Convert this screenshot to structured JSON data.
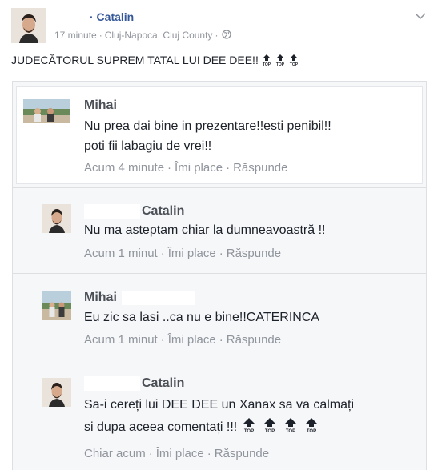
{
  "post": {
    "author": "· Catalin",
    "time": "17 minute",
    "location": "Cluj-Napoca, Cluj County",
    "separator": "·",
    "text": "JUDECĂTORUL SUPREM TATAL LUI DEE DEE!!",
    "top_icon_label": "TOP"
  },
  "comments": [
    {
      "name": "Mihai",
      "lines": [
        "Nu prea dai bine in prezentare!!esti penibil!!",
        "poti fii labagiu de vrei!!"
      ],
      "time": "Acum 4 minute",
      "like": "Îmi place",
      "reply": "Răspunde"
    },
    {
      "name": "Catalin",
      "lines": [
        "Nu ma asteptam chiar la dumneavoastră !!"
      ],
      "time": "Acum 1 minut",
      "like": "Îmi place",
      "reply": "Răspunde"
    },
    {
      "name": "Mihai",
      "lines": [
        "Eu zic sa lasi ..ca nu e bine!!CATERINCA"
      ],
      "time": "Acum 1 minut",
      "like": "Îmi place",
      "reply": "Răspunde"
    },
    {
      "name": "Catalin",
      "lines": [
        "Sa-i cereți lui DEE DEE un Xanax sa va calmați",
        "si dupa aceea comentați !!!"
      ],
      "time": "Chiar acum",
      "like": "Îmi place",
      "reply": "Răspunde"
    }
  ],
  "colors": {
    "link": "#365899",
    "meta": "#90949c",
    "text": "#1d2129",
    "name": "#4b4f56"
  },
  "icons": {
    "chevron": "chevron-down-icon",
    "globe": "globe-icon",
    "top": "top-arrow-icon"
  }
}
